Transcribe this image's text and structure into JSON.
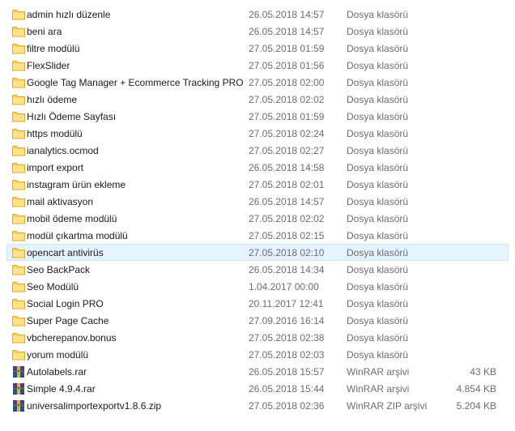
{
  "files": [
    {
      "name": "admin hızlı düzenle",
      "date": "26.05.2018 14:57",
      "type": "Dosya klasörü",
      "size": "",
      "icon": "folder-icon"
    },
    {
      "name": "beni ara",
      "date": "26.05.2018 14:57",
      "type": "Dosya klasörü",
      "size": "",
      "icon": "folder-icon"
    },
    {
      "name": "filtre modülü",
      "date": "27.05.2018 01:59",
      "type": "Dosya klasörü",
      "size": "",
      "icon": "folder-icon"
    },
    {
      "name": "FlexSlider",
      "date": "27.05.2018 01:56",
      "type": "Dosya klasörü",
      "size": "",
      "icon": "folder-icon"
    },
    {
      "name": "Google Tag Manager + Ecommerce Tracking PRO",
      "date": "27.05.2018 02:00",
      "type": "Dosya klasörü",
      "size": "",
      "icon": "folder-icon"
    },
    {
      "name": "hızlı ödeme",
      "date": "27.05.2018 02:02",
      "type": "Dosya klasörü",
      "size": "",
      "icon": "folder-icon"
    },
    {
      "name": "Hızlı Ödeme Sayfası",
      "date": "27.05.2018 01:59",
      "type": "Dosya klasörü",
      "size": "",
      "icon": "folder-icon"
    },
    {
      "name": "https modülü",
      "date": "27.05.2018 02:24",
      "type": "Dosya klasörü",
      "size": "",
      "icon": "folder-icon"
    },
    {
      "name": "ianalytics.ocmod",
      "date": "27.05.2018 02:27",
      "type": "Dosya klasörü",
      "size": "",
      "icon": "folder-icon"
    },
    {
      "name": "import export",
      "date": "26.05.2018 14:58",
      "type": "Dosya klasörü",
      "size": "",
      "icon": "folder-icon"
    },
    {
      "name": "instagram ürün ekleme",
      "date": "27.05.2018 02:01",
      "type": "Dosya klasörü",
      "size": "",
      "icon": "folder-icon"
    },
    {
      "name": "mail aktivasyon",
      "date": "26.05.2018 14:57",
      "type": "Dosya klasörü",
      "size": "",
      "icon": "folder-icon"
    },
    {
      "name": "mobil ödeme modülü",
      "date": "27.05.2018 02:02",
      "type": "Dosya klasörü",
      "size": "",
      "icon": "folder-icon"
    },
    {
      "name": "modül çıkartma modülü",
      "date": "27.05.2018 02:15",
      "type": "Dosya klasörü",
      "size": "",
      "icon": "folder-icon"
    },
    {
      "name": "opencart antivirüs",
      "date": "27.05.2018 02:10",
      "type": "Dosya klasörü",
      "size": "",
      "icon": "folder-icon",
      "selected": true
    },
    {
      "name": "Seo BackPack",
      "date": "26.05.2018 14:34",
      "type": "Dosya klasörü",
      "size": "",
      "icon": "folder-icon"
    },
    {
      "name": "Seo Modülü",
      "date": "1.04.2017 00:00",
      "type": "Dosya klasörü",
      "size": "",
      "icon": "folder-icon"
    },
    {
      "name": "Social Login PRO",
      "date": "20.11.2017 12:41",
      "type": "Dosya klasörü",
      "size": "",
      "icon": "folder-icon"
    },
    {
      "name": "Super Page Cache",
      "date": "27.09.2016 16:14",
      "type": "Dosya klasörü",
      "size": "",
      "icon": "folder-icon"
    },
    {
      "name": "vbcherepanov.bonus",
      "date": "27.05.2018 02:38",
      "type": "Dosya klasörü",
      "size": "",
      "icon": "folder-icon"
    },
    {
      "name": "yorum modülü",
      "date": "27.05.2018 02:03",
      "type": "Dosya klasörü",
      "size": "",
      "icon": "folder-icon"
    },
    {
      "name": "Autolabels.rar",
      "date": "26.05.2018 15:57",
      "type": "WinRAR arşivi",
      "size": "43 KB",
      "icon": "winrar-archive-icon"
    },
    {
      "name": "Simple 4.9.4.rar",
      "date": "26.05.2018 15:44",
      "type": "WinRAR arşivi",
      "size": "4.854 KB",
      "icon": "winrar-archive-icon"
    },
    {
      "name": "universalimportexportv1.8.6.zip",
      "date": "27.05.2018 02:36",
      "type": "WinRAR ZIP arşivi",
      "size": "5.204 KB",
      "icon": "winrar-archive-icon"
    }
  ],
  "colors": {
    "selection_bg": "#e5f3ff",
    "selection_border": "#cce8ff",
    "folder": "#ffd255",
    "detail_text": "#6d6d6d"
  }
}
